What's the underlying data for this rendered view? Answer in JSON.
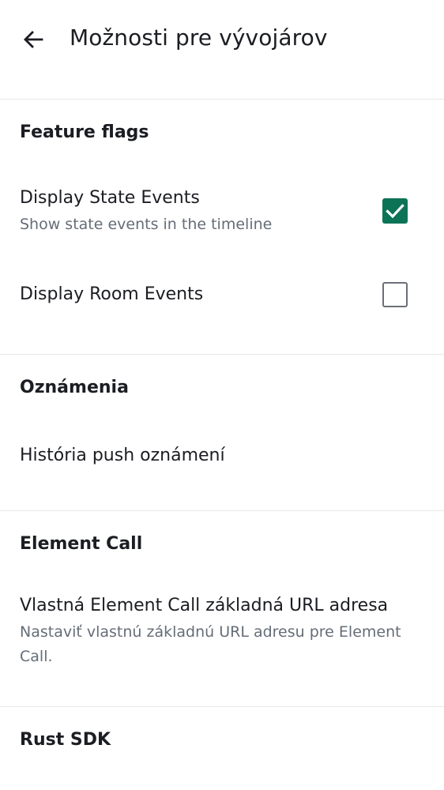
{
  "header": {
    "title": "Možnosti pre vývojárov",
    "back_icon": "arrow-left-icon"
  },
  "sections": [
    {
      "title": "Feature flags",
      "items": [
        {
          "title": "Display State Events",
          "subtitle": "Show state events in the timeline",
          "checked": true
        },
        {
          "title": "Display Room Events",
          "subtitle": "",
          "checked": false
        }
      ]
    },
    {
      "title": "Oznámenia",
      "items": [
        {
          "title": "História push oznámení",
          "subtitle": ""
        }
      ]
    },
    {
      "title": "Element Call",
      "items": [
        {
          "title": "Vlastná Element Call základná URL adresa",
          "subtitle": "Nastaviť vlastnú základnú URL adresu pre Element Call."
        }
      ]
    },
    {
      "title": "Rust SDK",
      "items": []
    }
  ],
  "colors": {
    "accent": "#0d7356",
    "text_primary": "#1b1d22",
    "text_secondary": "#656d77",
    "divider": "#e6e8eb"
  }
}
